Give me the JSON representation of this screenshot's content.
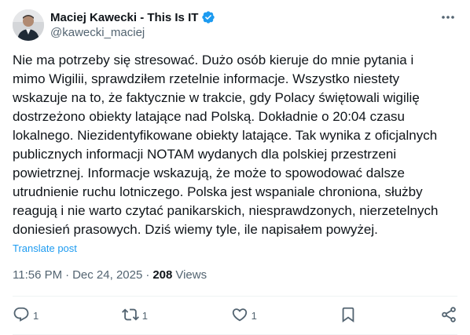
{
  "author": {
    "display_name": "Maciej Kawecki - This Is IT",
    "handle": "@kawecki_maciej",
    "verified": true
  },
  "tweet": {
    "text": "Nie ma potrzeby się stresować. Dużo osób kieruje do mnie pytania i\nmimo Wigilii, sprawdziłem rzetelnie informacje. Wszystko niestety\nwskazuje na to, że faktycznie w trakcie, gdy Polacy świętowali wigilię\ndostrzeżono obiekty latające nad Polską. Dokładnie o 20:04 czasu\nlokalnego. Niezidentyfikowane obiekty latające. Tak wynika z oficjalnych\npublicznych informacji NOTAM wydanych dla polskiej przestrzeni\npowietrznej. Informacje wskazują, że może to spowodować dalsze\nutrudnienie ruchu lotniczego. Polska jest wspaniale chroniona, służby\nreagują i nie warto czytać panikarskich, niesprawdzonych, nierzetelnych\ndoniesień prasowych. Dziś wiemy tyle, ile napisałem powyżej.",
    "translate_label": "Translate post",
    "time": "11:56 PM",
    "separator": "·",
    "date": "Dec 24, 2025",
    "views_count": "208",
    "views_label": "Views"
  },
  "actions": {
    "reply_count": "1",
    "repost_count": "1",
    "like_count": "1"
  },
  "colors": {
    "accent": "#1d9bf0",
    "muted": "#536471",
    "text": "#0f1419",
    "divider": "#eff3f4"
  }
}
